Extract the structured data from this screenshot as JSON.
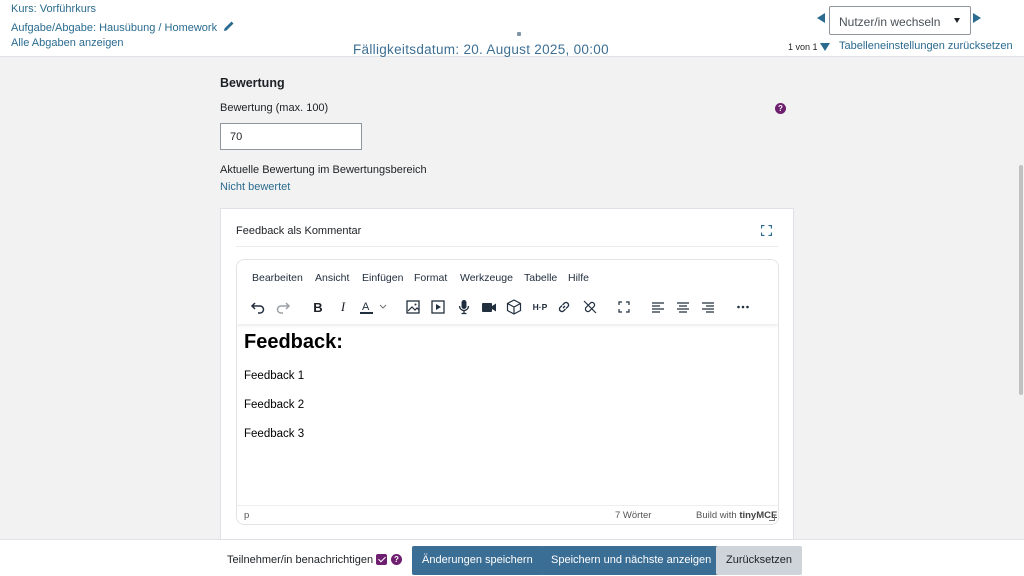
{
  "header": {
    "course_link": "Kurs: Vorführkurs",
    "assignment_link": "Aufgabe/Abgabe: Hausübung / Homework",
    "all_submissions_link": "Alle Abgaben anzeigen",
    "due_date": "Fälligkeitsdatum: 20. August 2025, 00:00",
    "user_select_placeholder": "Nutzer/in wechseln",
    "pager_text": "1 von 1",
    "reset_table_link": "Tabelleneinstellungen zurücksetzen"
  },
  "grading": {
    "title": "Bewertung",
    "grade_label": "Bewertung (max. 100)",
    "grade_value": "70",
    "current_grade_label": "Aktuelle Bewertung im Bewertungsbereich",
    "current_grade_status": "Nicht bewertet"
  },
  "feedback": {
    "title": "Feedback als Kommentar",
    "menu": [
      "Bearbeiten",
      "Ansicht",
      "Einfügen",
      "Format",
      "Werkzeuge",
      "Tabelle",
      "Hilfe"
    ],
    "content_heading": "Feedback:",
    "content_lines": [
      "Feedback 1",
      "Feedback 2",
      "Feedback 3"
    ],
    "status_path": "p",
    "word_count": "7 Wörter",
    "build_with": "Build with",
    "brand": "tinyMCE"
  },
  "footer": {
    "notify_label": "Teilnehmer/in benachrichtigen",
    "notify_checked": true,
    "save_button": "Änderungen speichern",
    "save_next_button": "Speichern und nächste anzeigen",
    "reset_button": "Zurücksetzen"
  },
  "colors": {
    "link": "#2a6b8f",
    "primary_button": "#3b6e95",
    "accent": "#6f1f70"
  }
}
